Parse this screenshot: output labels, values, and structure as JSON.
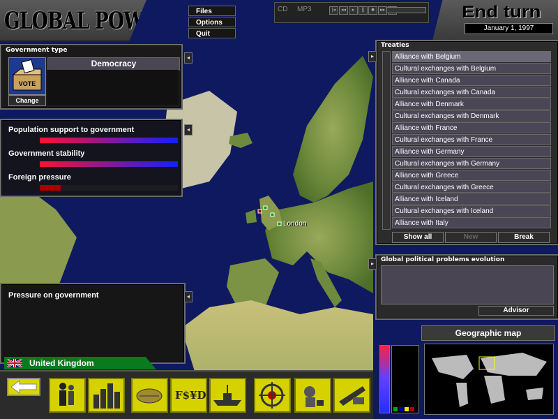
{
  "app": {
    "title": "GLOBAL POWER"
  },
  "menu": {
    "items": [
      "Files",
      "Options",
      "Quit"
    ]
  },
  "media": {
    "cd_label": "CD",
    "mp3_label": "MP3"
  },
  "turn": {
    "end_label": "End turn",
    "date": "January 1, 1997"
  },
  "government": {
    "title": "Government type",
    "type": "Democracy",
    "ballot_text": "VOTE",
    "change_label": "Change"
  },
  "stats": {
    "items": [
      {
        "label": "Population support to government",
        "fill": 1.0,
        "color_start": "#ff1030",
        "color_end": "#1020ff"
      },
      {
        "label": "Government stability",
        "fill": 1.0,
        "color_start": "#ff1030",
        "color_end": "#1020ff"
      },
      {
        "label": "Foreign pressure",
        "fill": 0.15,
        "color_start": "#aa0000",
        "color_end": "#aa0000"
      }
    ]
  },
  "pressure": {
    "title": "Pressure on government"
  },
  "country": {
    "name": "United Kingdom",
    "capital": "London"
  },
  "treaties": {
    "title": "Treaties",
    "items": [
      "Alliance with Belgium",
      "Cultural exchanges with Belgium",
      "Alliance with Canada",
      "Cultural exchanges with Canada",
      "Alliance with Denmark",
      "Cultural exchanges with Denmark",
      "Alliance with France",
      "Cultural exchanges with France",
      "Alliance with Germany",
      "Cultural exchanges with Germany",
      "Alliance with Greece",
      "Cultural exchanges with Greece",
      "Alliance with Iceland",
      "Cultural exchanges with Iceland",
      "Alliance with Italy"
    ],
    "show_all_label": "Show all",
    "new_label": "New",
    "break_label": "Break"
  },
  "global_problems": {
    "title": "Global political problems evolution",
    "advisor_label": "Advisor"
  },
  "geo": {
    "title": "Geographic map"
  },
  "toolbar": {
    "buttons": [
      "population-icon",
      "industry-icon",
      "trade-icon",
      "finance-icon",
      "military-ship-icon",
      "target-icon",
      "research-icon",
      "weapons-icon"
    ],
    "finance_text": "F$¥DM"
  },
  "colors": {
    "accent": "#d6d200",
    "ocean": "#101a5e",
    "land": "#7a9a40",
    "country_bar": "#0a7a1e"
  }
}
